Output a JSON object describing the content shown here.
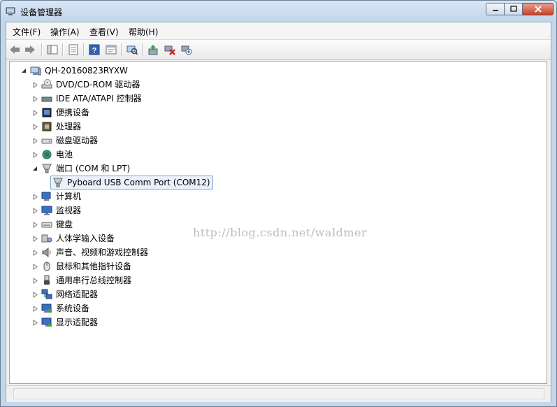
{
  "window": {
    "title": "设备管理器"
  },
  "menubar": {
    "items": [
      "文件(F)",
      "操作(A)",
      "查看(V)",
      "帮助(H)"
    ]
  },
  "toolbar": {
    "buttons": [
      "back-arrow-icon",
      "forward-arrow-icon",
      "show-hide-tree-icon",
      "properties-icon",
      "help-icon",
      "view-icon",
      "scan-hardware-icon",
      "update-driver-icon",
      "disable-device-icon",
      "uninstall-device-icon"
    ]
  },
  "tree": {
    "root": {
      "label": "QH-20160823RYXW",
      "icon": "computer-icon"
    },
    "items": [
      {
        "label": "DVD/CD-ROM 驱动器",
        "icon": "dvd-drive-icon",
        "expanded": false
      },
      {
        "label": "IDE ATA/ATAPI 控制器",
        "icon": "ide-controller-icon",
        "expanded": false
      },
      {
        "label": "便携设备",
        "icon": "portable-device-icon",
        "expanded": false
      },
      {
        "label": "处理器",
        "icon": "processor-icon",
        "expanded": false
      },
      {
        "label": "磁盘驱动器",
        "icon": "disk-drive-icon",
        "expanded": false
      },
      {
        "label": "电池",
        "icon": "battery-icon",
        "expanded": false
      },
      {
        "label": "端口 (COM 和 LPT)",
        "icon": "port-icon",
        "expanded": true,
        "children": [
          {
            "label": "Pyboard USB Comm Port (COM12)",
            "icon": "port-icon",
            "selected": true
          }
        ]
      },
      {
        "label": "计算机",
        "icon": "computer-category-icon",
        "expanded": false
      },
      {
        "label": "监视器",
        "icon": "monitor-icon",
        "expanded": false
      },
      {
        "label": "键盘",
        "icon": "keyboard-icon",
        "expanded": false
      },
      {
        "label": "人体学输入设备",
        "icon": "hid-icon",
        "expanded": false
      },
      {
        "label": "声音、视频和游戏控制器",
        "icon": "sound-icon",
        "expanded": false
      },
      {
        "label": "鼠标和其他指针设备",
        "icon": "mouse-icon",
        "expanded": false
      },
      {
        "label": "通用串行总线控制器",
        "icon": "usb-icon",
        "expanded": false
      },
      {
        "label": "网络适配器",
        "icon": "network-adapter-icon",
        "expanded": false
      },
      {
        "label": "系统设备",
        "icon": "system-device-icon",
        "expanded": false
      },
      {
        "label": "显示适配器",
        "icon": "display-adapter-icon",
        "expanded": false
      }
    ]
  },
  "watermark": "http://blog.csdn.net/waldmer",
  "colors": {
    "selection_border": "#7da2ce",
    "selection_fill": "#e9f2fb",
    "watermark": "#bdbdbd"
  }
}
